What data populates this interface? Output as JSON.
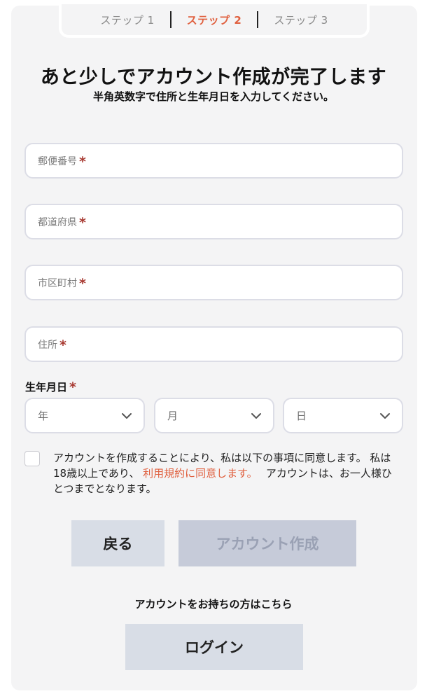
{
  "steps": [
    {
      "label": "ステップ 1",
      "active": false
    },
    {
      "label": "ステップ 2",
      "active": true
    },
    {
      "label": "ステップ 3",
      "active": false
    }
  ],
  "title": "あと少しでアカウント作成が完了します",
  "subtitle": "半角英数字で住所と生年月日を入力してください。",
  "required_mark": "*",
  "fields": {
    "postal_code": "郵便番号",
    "prefecture": "都道府県",
    "city": "市区町村",
    "address": "住所"
  },
  "dob": {
    "label": "生年月日",
    "year": "年",
    "month": "月",
    "day": "日"
  },
  "consent": {
    "text_before": "アカウントを作成することにより、私は以下の事項に同意します。 私は18歳以上であり、 ",
    "link": "利用規約に同意します。",
    "text_after": "　 アカウントは、お一人様ひとつまでとなります。"
  },
  "buttons": {
    "back": "戻る",
    "create": "アカウント作成",
    "login": "ログイン"
  },
  "login_prompt": "アカウントをお持ちの方はこちら",
  "colors": {
    "accent": "#e0603f",
    "required": "#a83a32",
    "button_bg": "#d8dde6",
    "button_disabled_bg": "#c6cbd9"
  }
}
